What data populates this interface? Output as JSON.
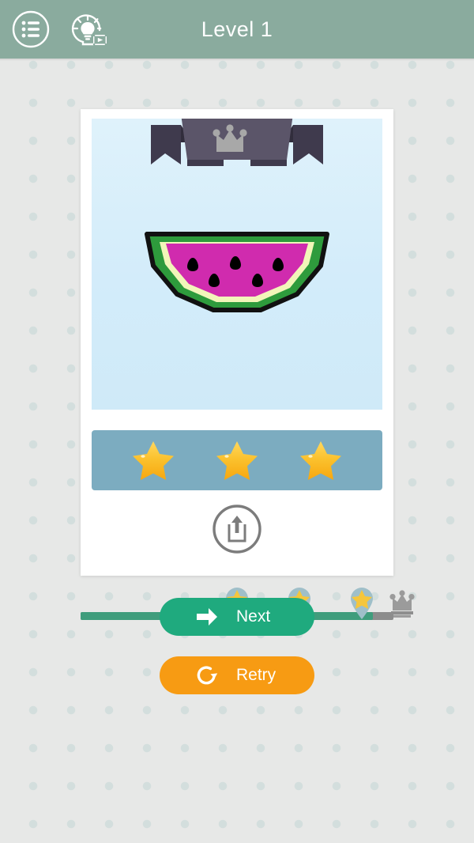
{
  "header": {
    "title": "Level 1",
    "background_color": "#8aab9e",
    "title_color": "#ffffff",
    "icons": [
      {
        "name": "levels-list-icon",
        "label": "Levels"
      },
      {
        "name": "hint-video-icon",
        "label": "Hint"
      }
    ]
  },
  "card": {
    "background_color": "#ffffff",
    "picture_panel_color": "#d6eef8",
    "banner": {
      "name": "crown-banner",
      "ribbon_color": "#4b4559",
      "ribbon_face_color": "#5b5569",
      "crown_color": "#a8a8a8"
    },
    "illustration": {
      "name": "watermelon-illustration",
      "subject": "watermelon slice",
      "flesh_color": "#d02bae",
      "inner_rind_color": "#f2f6b9",
      "outer_rind_color": "#2e9b3c",
      "outline_color": "#111111",
      "seed_color": "#000000",
      "seed_count": 5
    },
    "stars": {
      "name": "score-stars",
      "bar_color": "#7cacc0",
      "earned": 3,
      "total": 3,
      "star_color": "#f7b719",
      "star_highlight_color": "#ffd75e"
    },
    "share": {
      "name": "share-button",
      "label": "Share",
      "icon_color": "#7c7c7c"
    }
  },
  "progress": {
    "fill_color": "#3f9d7c",
    "track_color": "#8c8c8c",
    "percent": 93,
    "milestones": [
      {
        "name": "milestone-star-1",
        "position_percent": 50,
        "unlocked": true
      },
      {
        "name": "milestone-star-2",
        "position_percent": 70,
        "unlocked": true
      },
      {
        "name": "milestone-star-3",
        "position_percent": 90,
        "unlocked": true
      }
    ],
    "end_badge": {
      "name": "crown-trophy-icon",
      "color": "#9b9b9b"
    }
  },
  "actions": {
    "next": {
      "label": "Next",
      "color": "#1faa7e",
      "icon": "arrow-right-icon"
    },
    "retry": {
      "label": "Retry",
      "color": "#f79b13",
      "icon": "refresh-icon"
    }
  },
  "background": {
    "color": "#e7e8e7",
    "dot_color": "#d3dedd"
  }
}
